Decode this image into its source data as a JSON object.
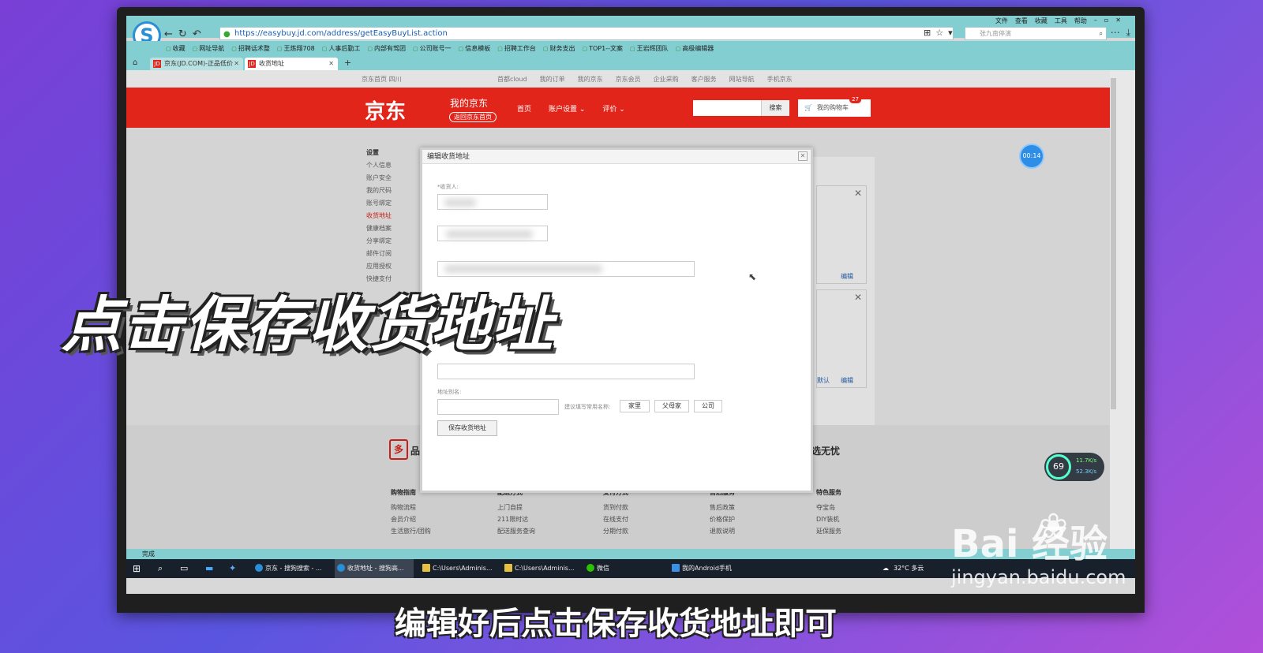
{
  "browser": {
    "url": "https://easybuy.jd.com/address/getEasyBuyList.action",
    "menu": [
      "文件",
      "查看",
      "收藏",
      "工具",
      "帮助"
    ],
    "search_placeholder": "张九南停演",
    "bookmarks": [
      "收藏",
      "网址导航",
      "招聘话术整",
      "王炼翔708",
      "人事后勤工",
      "内部有驾团",
      "公司账号一",
      "信息模板",
      "招聘工作台",
      "财务支出",
      "TOP1--文案",
      "王岩辉团队",
      "高级编辑器"
    ],
    "tabs": [
      {
        "label": "京东(JD.COM)-正品低价"
      },
      {
        "label": "收货地址"
      }
    ],
    "status": "完成"
  },
  "site": {
    "topnav_left": "京东首页  四川",
    "topnav_right": [
      "首都cloud",
      "我的订单",
      "我的京东",
      "京东会员",
      "企业采购",
      "客户服务",
      "网站导航",
      "手机京东"
    ],
    "logo": "京东",
    "myjd": "我的京东",
    "back_home": "返回京东首页",
    "nav": [
      "首页",
      "账户设置 ⌄",
      "评价 ⌄"
    ],
    "search_button": "搜索",
    "cart_label": "我的购物车",
    "cart_count": "27"
  },
  "sidemenu": {
    "heading": "设置",
    "items": [
      "个人信息",
      "账户安全",
      "我的尺码",
      "账号绑定",
      "收货地址",
      "健康档案",
      "分享绑定",
      "邮件订阅",
      "应用授权",
      "快捷支付"
    ],
    "active": "收货地址"
  },
  "address_cards": [
    {
      "edit": "编辑",
      "default": ""
    },
    {
      "edit": "编辑",
      "default": "默认"
    }
  ],
  "modal": {
    "title": "编辑收货地址",
    "receiver_label": "*收货人:",
    "alias_label": "地址别名:",
    "suggest_label": "建议填写常用名称:",
    "suggestions": [
      "家里",
      "父母家",
      "公司"
    ],
    "save_button": "保存收货地址"
  },
  "footer": {
    "tag_icon": "多",
    "tag_left": "品",
    "tag_right": "选无忧",
    "columns": [
      {
        "title": "购物指南",
        "items": [
          "购物流程",
          "会员介绍",
          "生活旅行/团购"
        ]
      },
      {
        "title": "配送方式",
        "items": [
          "上门自提",
          "211限时达",
          "配送服务查询"
        ]
      },
      {
        "title": "支付方式",
        "items": [
          "货到付款",
          "在线支付",
          "分期付款"
        ]
      },
      {
        "title": "售后服务",
        "items": [
          "售后政策",
          "价格保护",
          "退款说明"
        ]
      },
      {
        "title": "特色服务",
        "items": [
          "夺宝岛",
          "DIY装机",
          "延保服务"
        ]
      }
    ]
  },
  "taskbar": {
    "apps": [
      "京东 - 搜狗搜索 - ...",
      "收货地址 - 搜狗高...",
      "C:\\Users\\Adminis...",
      "C:\\Users\\Adminis...",
      "微信",
      "我的Android手机"
    ],
    "weather": "32°C  多云"
  },
  "overlays": {
    "timer": "00:14",
    "speed_pct": "69",
    "speed_up": "11.7K/s",
    "speed_down": "52.3K/s",
    "caption_main": "点击保存收货地址",
    "caption_sub": "编辑好后点击保存收货地址即可",
    "watermark_main": "Bai 经验",
    "watermark_sub": "jingyan.baidu.com"
  }
}
